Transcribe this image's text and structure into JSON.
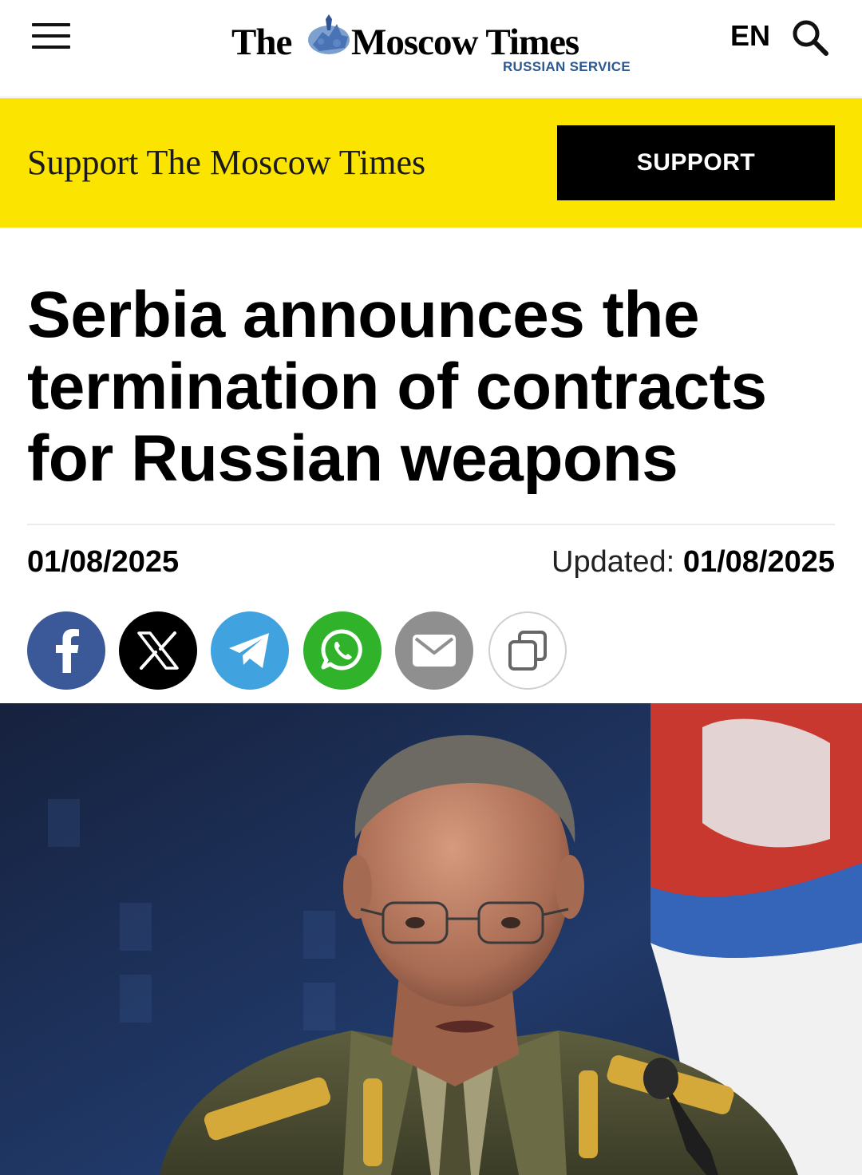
{
  "header": {
    "menu_icon": "hamburger-menu-icon",
    "logo": {
      "the": "The",
      "name": "Moscow Times",
      "subtitle": "RUSSIAN SERVICE"
    },
    "language": "EN",
    "search_icon": "search-icon"
  },
  "banner": {
    "text": "Support The Moscow Times",
    "button_label": "SUPPORT",
    "background_color": "#fbe400"
  },
  "article": {
    "headline": "Serbia announces the termination of contracts for Russian weapons",
    "date": "01/08/2025",
    "updated_label": "Updated:",
    "updated_date": "01/08/2025"
  },
  "share": {
    "buttons": [
      {
        "icon": "facebook-icon",
        "color": "#3b5998"
      },
      {
        "icon": "x-icon",
        "color": "#000000"
      },
      {
        "icon": "telegram-icon",
        "color": "#40a3e0"
      },
      {
        "icon": "whatsapp-icon",
        "color": "#30b32b"
      },
      {
        "icon": "mail-icon",
        "color": "#8f8f8f"
      },
      {
        "icon": "copy-link-icon",
        "color": "#ffffff"
      }
    ]
  }
}
